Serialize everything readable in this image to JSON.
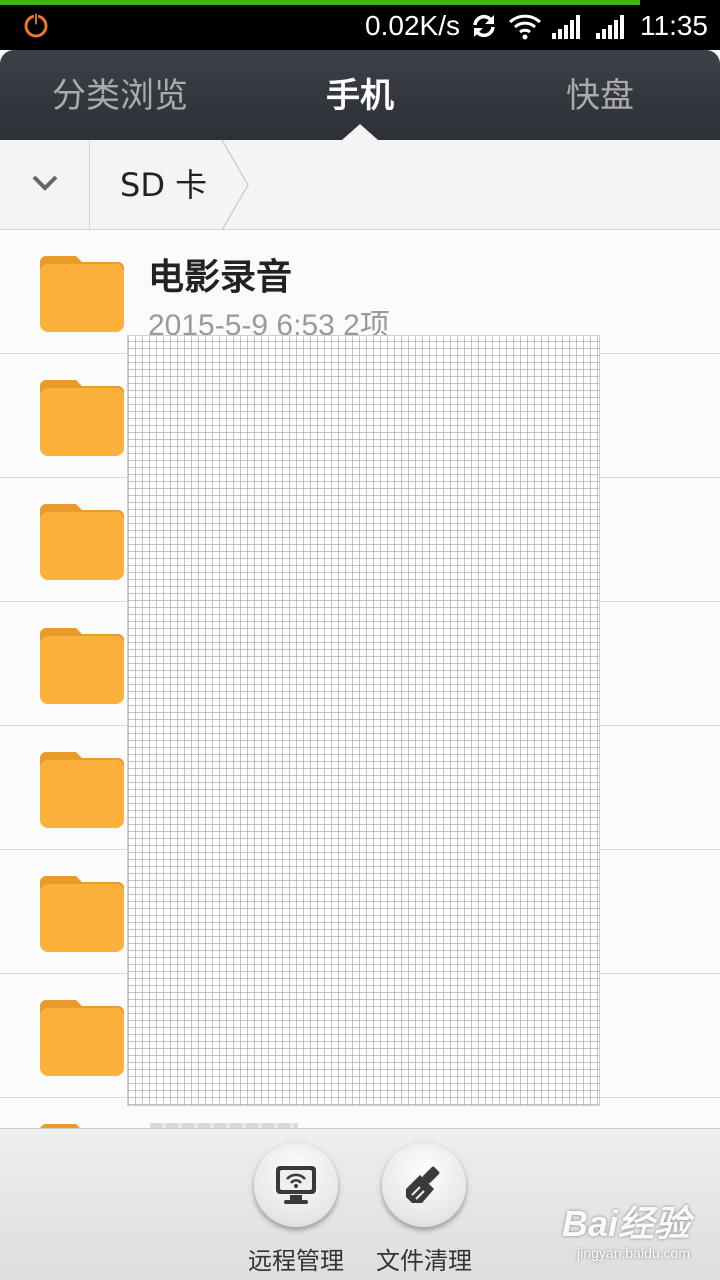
{
  "status_bar": {
    "network_speed": "0.02K/s",
    "time": "11:35",
    "icons": [
      "power-icon",
      "sync-icon",
      "wifi-icon",
      "signal-icon",
      "signal-icon"
    ]
  },
  "tabs": [
    {
      "label": "分类浏览",
      "active": false
    },
    {
      "label": "手机",
      "active": true
    },
    {
      "label": "快盘",
      "active": false
    }
  ],
  "breadcrumb": {
    "path": "SD 卡"
  },
  "files": [
    {
      "name": "电影录音",
      "meta": "2015-5-9 6:53  2项",
      "blurred": false
    },
    {
      "name": "",
      "meta": "",
      "blurred": true
    },
    {
      "name": "",
      "meta": "",
      "blurred": true
    },
    {
      "name": "",
      "meta": "",
      "blurred": true
    },
    {
      "name": "",
      "meta": "",
      "blurred": true
    },
    {
      "name": "",
      "meta": "",
      "blurred": true
    },
    {
      "name": "",
      "meta": "",
      "blurred": true
    },
    {
      "name": "",
      "meta": "",
      "blurred": true
    }
  ],
  "toolbar": {
    "remote_label": "远程管理",
    "clean_label": "文件清理"
  },
  "watermark": {
    "brand": "Bai经验",
    "site": "jingyan.baidu.com"
  },
  "colors": {
    "folder": "#fcb03c",
    "tab_bar": "#35383e",
    "progress": "#3fb618"
  }
}
